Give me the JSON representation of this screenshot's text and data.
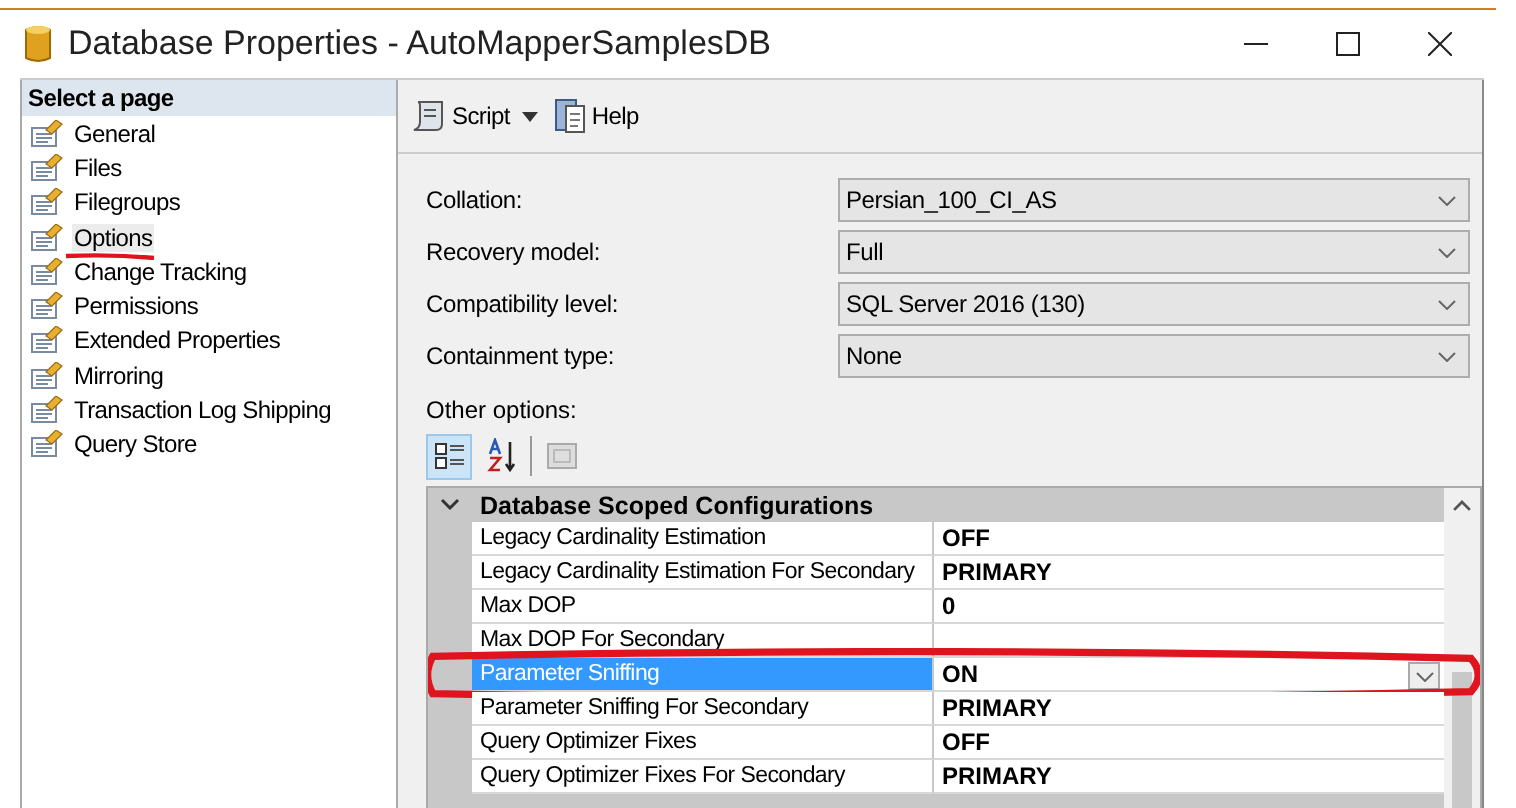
{
  "window": {
    "title": "Database Properties - AutoMapperSamplesDB"
  },
  "sidebar": {
    "heading": "Select a page",
    "items": [
      {
        "label": "General",
        "selected": false,
        "underlined": false
      },
      {
        "label": "Files",
        "selected": false,
        "underlined": false
      },
      {
        "label": "Filegroups",
        "selected": false,
        "underlined": false
      },
      {
        "label": "Options",
        "selected": true,
        "underlined": true
      },
      {
        "label": "Change Tracking",
        "selected": false,
        "underlined": false
      },
      {
        "label": "Permissions",
        "selected": false,
        "underlined": false
      },
      {
        "label": "Extended Properties",
        "selected": false,
        "underlined": false
      },
      {
        "label": "Mirroring",
        "selected": false,
        "underlined": false
      },
      {
        "label": "Transaction Log Shipping",
        "selected": false,
        "underlined": false
      },
      {
        "label": "Query Store",
        "selected": false,
        "underlined": false
      }
    ]
  },
  "toolbar": {
    "script": "Script",
    "help": "Help"
  },
  "fields": [
    {
      "label": "Collation:",
      "value": "Persian_100_CI_AS"
    },
    {
      "label": "Recovery model:",
      "value": "Full"
    },
    {
      "label": "Compatibility level:",
      "value": "SQL Server 2016 (130)"
    },
    {
      "label": "Containment type:",
      "value": "None"
    }
  ],
  "other_options": {
    "label": "Other options:",
    "grid": {
      "category": "Database Scoped Configurations",
      "expanded": true,
      "rows": [
        {
          "name": "Legacy Cardinality Estimation",
          "value": "OFF",
          "selected": false,
          "circled": false
        },
        {
          "name": "Legacy Cardinality Estimation For Secondary",
          "value": "PRIMARY",
          "selected": false,
          "circled": false
        },
        {
          "name": "Max DOP",
          "value": "0",
          "selected": false,
          "circled": false
        },
        {
          "name": "Max DOP For Secondary",
          "selected": false,
          "circled": false
        },
        {
          "name": "Parameter Sniffing",
          "value": "ON",
          "selected": true,
          "circled": true
        },
        {
          "name": "Parameter Sniffing For Secondary",
          "value": "PRIMARY",
          "selected": false,
          "circled": false
        },
        {
          "name": "Query Optimizer Fixes",
          "value": "OFF",
          "selected": false,
          "circled": false
        },
        {
          "name": "Query Optimizer Fixes For Secondary",
          "value": "PRIMARY",
          "selected": false,
          "circled": false
        }
      ]
    }
  }
}
